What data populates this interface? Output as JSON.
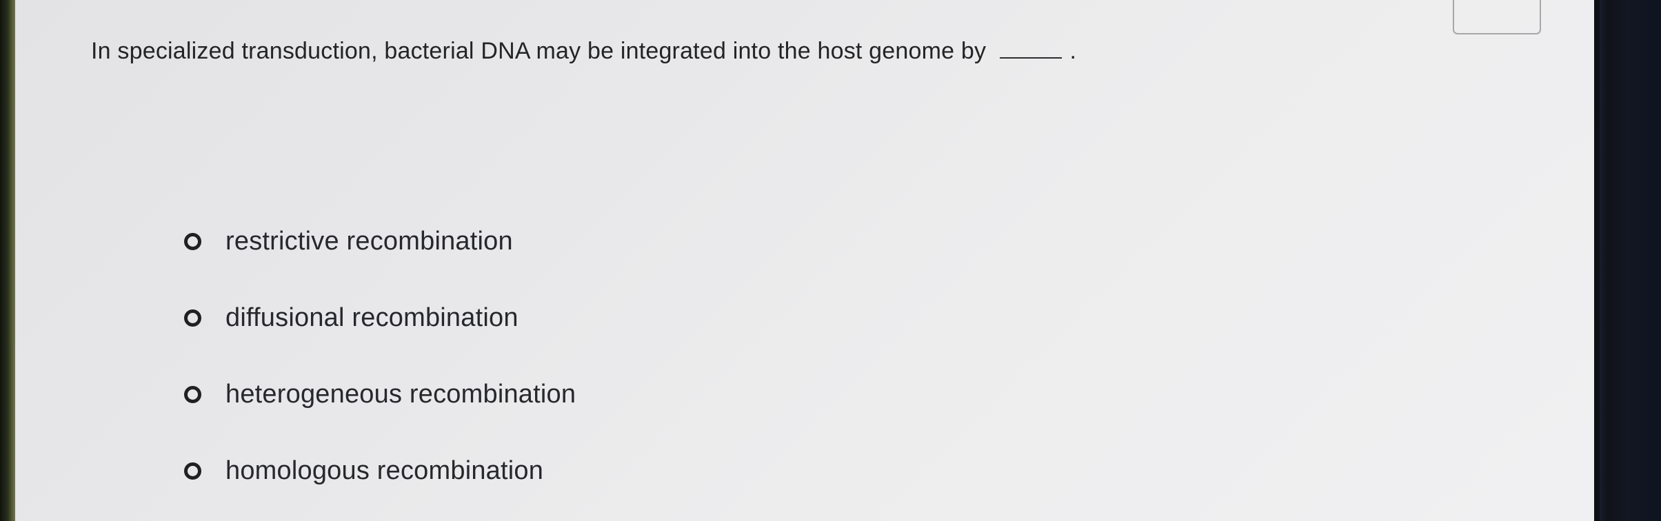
{
  "question": {
    "text": "In specialized transduction, bacterial DNA may be integrated into the host genome by",
    "blank": "",
    "trailing_punctuation": "."
  },
  "choices": [
    {
      "label": "restrictive recombination",
      "selected": false
    },
    {
      "label": "diffusional recombination",
      "selected": false
    },
    {
      "label": "heterogeneous recombination",
      "selected": false
    },
    {
      "label": "homologous recombination",
      "selected": false
    }
  ],
  "colors": {
    "text": "#232426",
    "radio_border": "#1f2022",
    "screen_background": "#e8e8ea",
    "corner_box_border": "#a7a7a9"
  },
  "icons": {
    "radio": "radio-unselected-icon"
  }
}
